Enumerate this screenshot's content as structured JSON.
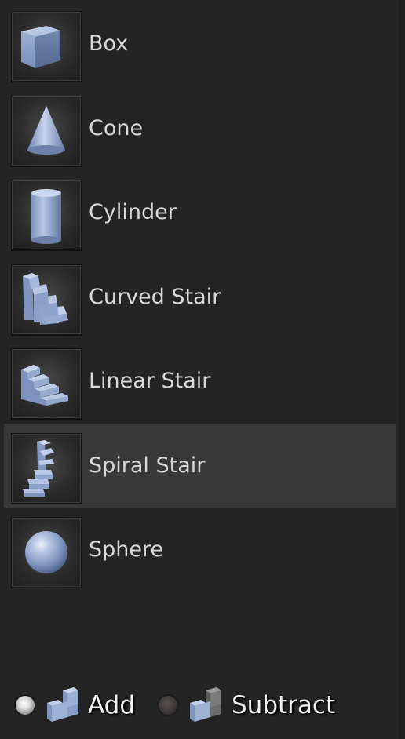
{
  "brush_list": {
    "items": [
      {
        "label": "Box",
        "icon": "box-icon",
        "selected": false
      },
      {
        "label": "Cone",
        "icon": "cone-icon",
        "selected": false
      },
      {
        "label": "Cylinder",
        "icon": "cylinder-icon",
        "selected": false
      },
      {
        "label": "Curved Stair",
        "icon": "curved-stair-icon",
        "selected": false
      },
      {
        "label": "Linear Stair",
        "icon": "linear-stair-icon",
        "selected": false
      },
      {
        "label": "Spiral Stair",
        "icon": "spiral-stair-icon",
        "selected": true
      },
      {
        "label": "Sphere",
        "icon": "sphere-icon",
        "selected": false
      }
    ]
  },
  "brush_mode": {
    "selected": "Add",
    "add_label": "Add",
    "subtract_label": "Subtract",
    "add_icon": "add-brush-icon",
    "subtract_icon": "subtract-brush-icon"
  },
  "colors": {
    "background": "#242424",
    "selected_row": "#383838",
    "shape_blue": "#8fa6cc",
    "text": "#d8d8d8"
  }
}
